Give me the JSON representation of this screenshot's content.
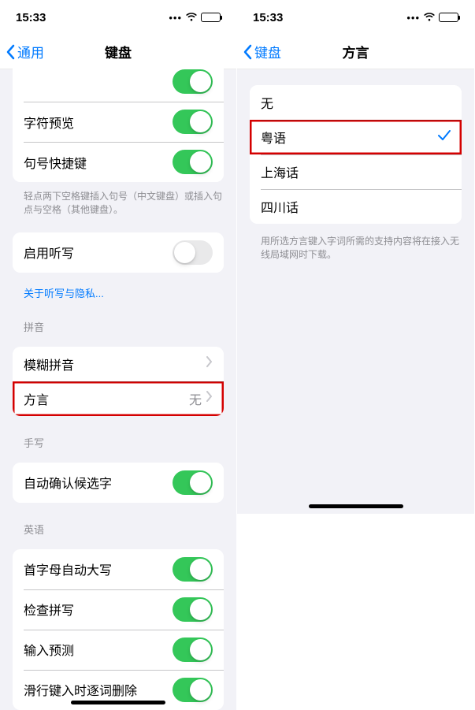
{
  "left": {
    "status": {
      "time": "15:33"
    },
    "nav": {
      "back": "通用",
      "title": "键盘"
    },
    "group1": {
      "rowA": {
        "label": "字符预览",
        "on": true
      },
      "rowB": {
        "label": "句号快捷键",
        "on": true
      },
      "note": "轻点两下空格键插入句号（中文键盘）或插入句点与空格（其他键盘）。"
    },
    "group2": {
      "rowA": {
        "label": "启用听写",
        "on": false
      },
      "link": "关于听写与隐私..."
    },
    "pinyin": {
      "header": "拼音",
      "rowA": {
        "label": "模糊拼音"
      },
      "rowB": {
        "label": "方言",
        "value": "无"
      }
    },
    "handwrite": {
      "header": "手写",
      "rowA": {
        "label": "自动确认候选字",
        "on": true
      }
    },
    "english": {
      "header": "英语",
      "rowA": {
        "label": "首字母自动大写",
        "on": true
      },
      "rowB": {
        "label": "检查拼写",
        "on": true
      },
      "rowC": {
        "label": "输入预测",
        "on": true
      },
      "rowD": {
        "label": "滑行键入时逐词删除",
        "on": true
      }
    }
  },
  "right": {
    "status": {
      "time": "15:33"
    },
    "nav": {
      "back": "键盘",
      "title": "方言"
    },
    "options": {
      "a": "无",
      "b": "粤语",
      "c": "上海话",
      "d": "四川话"
    },
    "note": "用所选方言键入字词所需的支持内容将在接入无线局域网时下载。"
  }
}
